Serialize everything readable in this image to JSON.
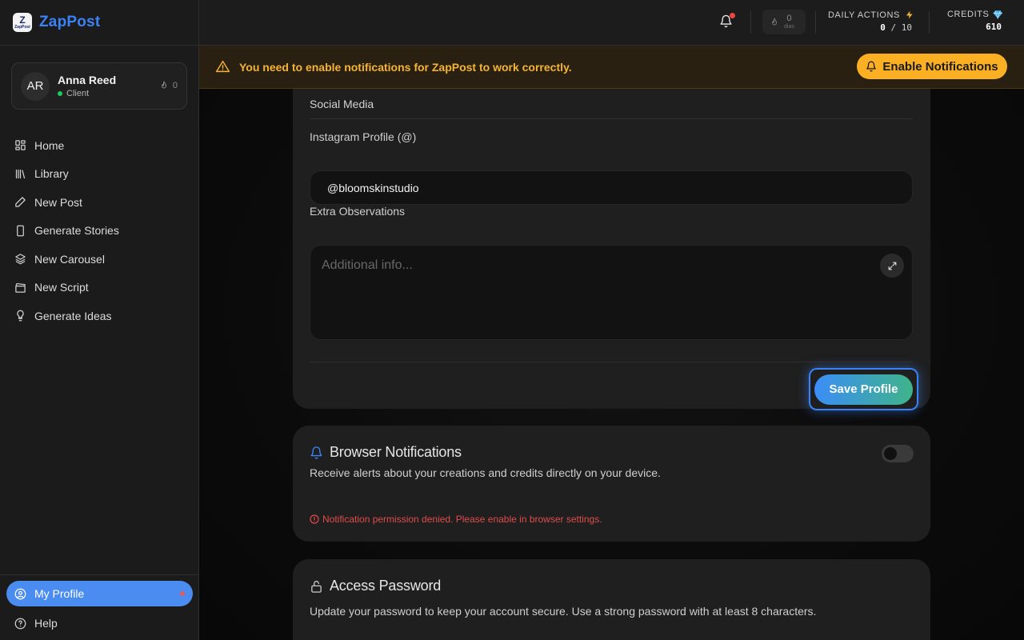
{
  "brand": {
    "name": "ZapPost",
    "logo_glyph": "Z",
    "logo_caption": "ZapPost"
  },
  "user": {
    "initials": "AR",
    "name": "Anna Reed",
    "role": "Client",
    "streak_count": "0"
  },
  "nav": {
    "items": [
      {
        "label": "Home",
        "icon": "home-grid-icon"
      },
      {
        "label": "Library",
        "icon": "library-icon"
      },
      {
        "label": "New Post",
        "icon": "pencil-icon"
      },
      {
        "label": "Generate Stories",
        "icon": "phone-icon"
      },
      {
        "label": "New Carousel",
        "icon": "layers-icon"
      },
      {
        "label": "New Script",
        "icon": "clapperboard-icon"
      },
      {
        "label": "Generate Ideas",
        "icon": "lightbulb-icon"
      }
    ],
    "my_profile": "My Profile",
    "help": "Help"
  },
  "topbar": {
    "streak_value": "0",
    "streak_unit": "dias",
    "daily_actions_label": "DAILY ACTIONS",
    "daily_actions_used": "0",
    "daily_actions_sep": "/",
    "daily_actions_max": "10",
    "credits_label": "CREDITS",
    "credits_value": "610"
  },
  "banner": {
    "message": "You need to enable notifications for ZapPost to work correctly.",
    "button": "Enable Notifications"
  },
  "profile_form": {
    "section_title": "Social Media",
    "instagram_label": "Instagram Profile (@)",
    "instagram_value": "@bloomskinstudio",
    "observations_label": "Extra Observations",
    "observations_placeholder": "Additional info...",
    "save_button": "Save Profile"
  },
  "notifications_card": {
    "title": "Browser Notifications",
    "description": "Receive alerts about your creations and credits directly on your device.",
    "error": "Notification permission denied. Please enable in browser settings.",
    "enabled": false
  },
  "password_card": {
    "title": "Access Password",
    "description": "Update your password to keep your account secure. Use a strong password with at least 8 characters."
  },
  "colors": {
    "accent": "#3b82f6",
    "warning": "#fbb024",
    "error": "#e24c4c",
    "success": "#22c55e"
  }
}
